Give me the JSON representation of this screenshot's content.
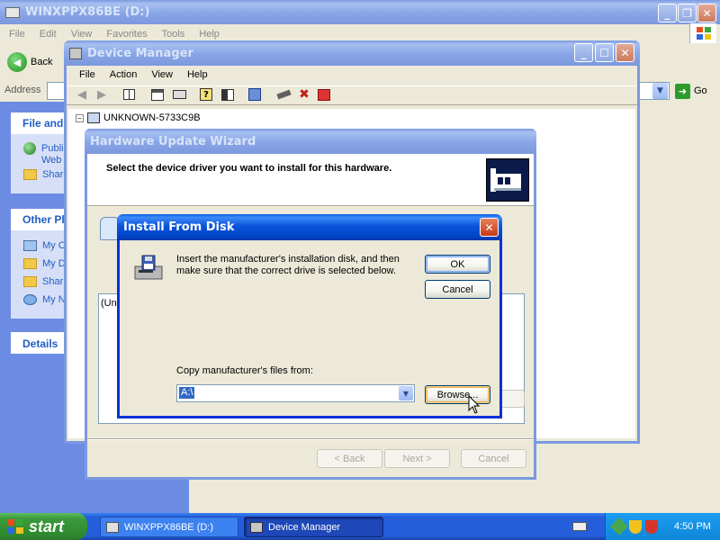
{
  "explorer": {
    "title": "WINXPPX86BE (D:)",
    "menu": [
      "File",
      "Edit",
      "View",
      "Favorites",
      "Tools",
      "Help"
    ],
    "back_label": "Back",
    "address_label": "Address",
    "go_label": "Go",
    "panels": {
      "file_tasks_title": "File and",
      "file_tasks": [
        "Publi",
        "Web",
        "Shar"
      ],
      "other_places_title": "Other Pl",
      "other_places": [
        "My C",
        "My D",
        "Shar",
        "My N"
      ],
      "details_title": "Details"
    }
  },
  "device_manager": {
    "title": "Device Manager",
    "menu": [
      "File",
      "Action",
      "View",
      "Help"
    ],
    "tree_root": "UNKNOWN-5733C9B"
  },
  "wizard": {
    "title": "Hardware Update Wizard",
    "heading": "Select the device driver you want to install for this hardware.",
    "list_fragment": "(Una",
    "back_label": "< Back",
    "next_label": "Next >",
    "cancel_label": "Cancel"
  },
  "install_dialog": {
    "title": "Install From Disk",
    "message": "Insert the manufacturer's installation disk, and then make sure that the correct drive is selected below.",
    "ok_label": "OK",
    "cancel_label": "Cancel",
    "copy_label": "Copy manufacturer's files from:",
    "path_value": "A:\\",
    "browse_label": "Browse..."
  },
  "taskbar": {
    "start_label": "start",
    "tasks": [
      {
        "label": "WINXPPX86BE (D:)",
        "active": false
      },
      {
        "label": "Device Manager",
        "active": true
      }
    ],
    "clock": "4:50 PM"
  },
  "colors": {
    "desktop_blue": "#5a7edc",
    "taskbar": "#245edb",
    "start_green": "#3c9a3c",
    "xp_face": "#ece9d8"
  }
}
